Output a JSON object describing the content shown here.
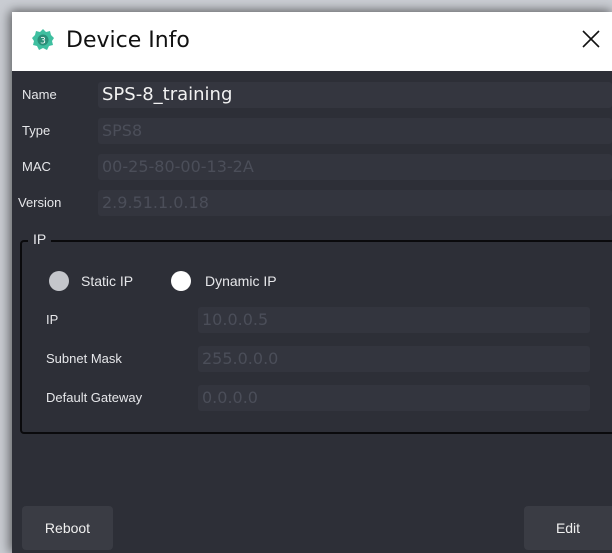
{
  "window": {
    "title": "Device Info"
  },
  "icons": {
    "app": "app-badge-icon",
    "close": "close-icon"
  },
  "fields": {
    "name": {
      "label": "Name",
      "value": "SPS-8_training"
    },
    "type": {
      "label": "Type",
      "value": "SPS8"
    },
    "mac": {
      "label": "MAC",
      "value": "00-25-80-00-13-2A"
    },
    "version": {
      "label": "Version",
      "value": "2.9.51.1.0.18"
    }
  },
  "ip_group": {
    "title": "IP",
    "static_label": "Static IP",
    "dynamic_label": "Dynamic IP",
    "selected": "Dynamic IP",
    "ip": {
      "label": "IP",
      "value": "10.0.0.5"
    },
    "subnet": {
      "label": "Subnet Mask",
      "value": "255.0.0.0"
    },
    "gateway": {
      "label": "Default Gateway",
      "value": "0.0.0.0"
    }
  },
  "buttons": {
    "reboot": "Reboot",
    "edit": "Edit"
  },
  "colors": {
    "background": "#2d2f37",
    "field": "#33353e",
    "text": "#e6e7ea",
    "accent": "#3fbfa0"
  }
}
